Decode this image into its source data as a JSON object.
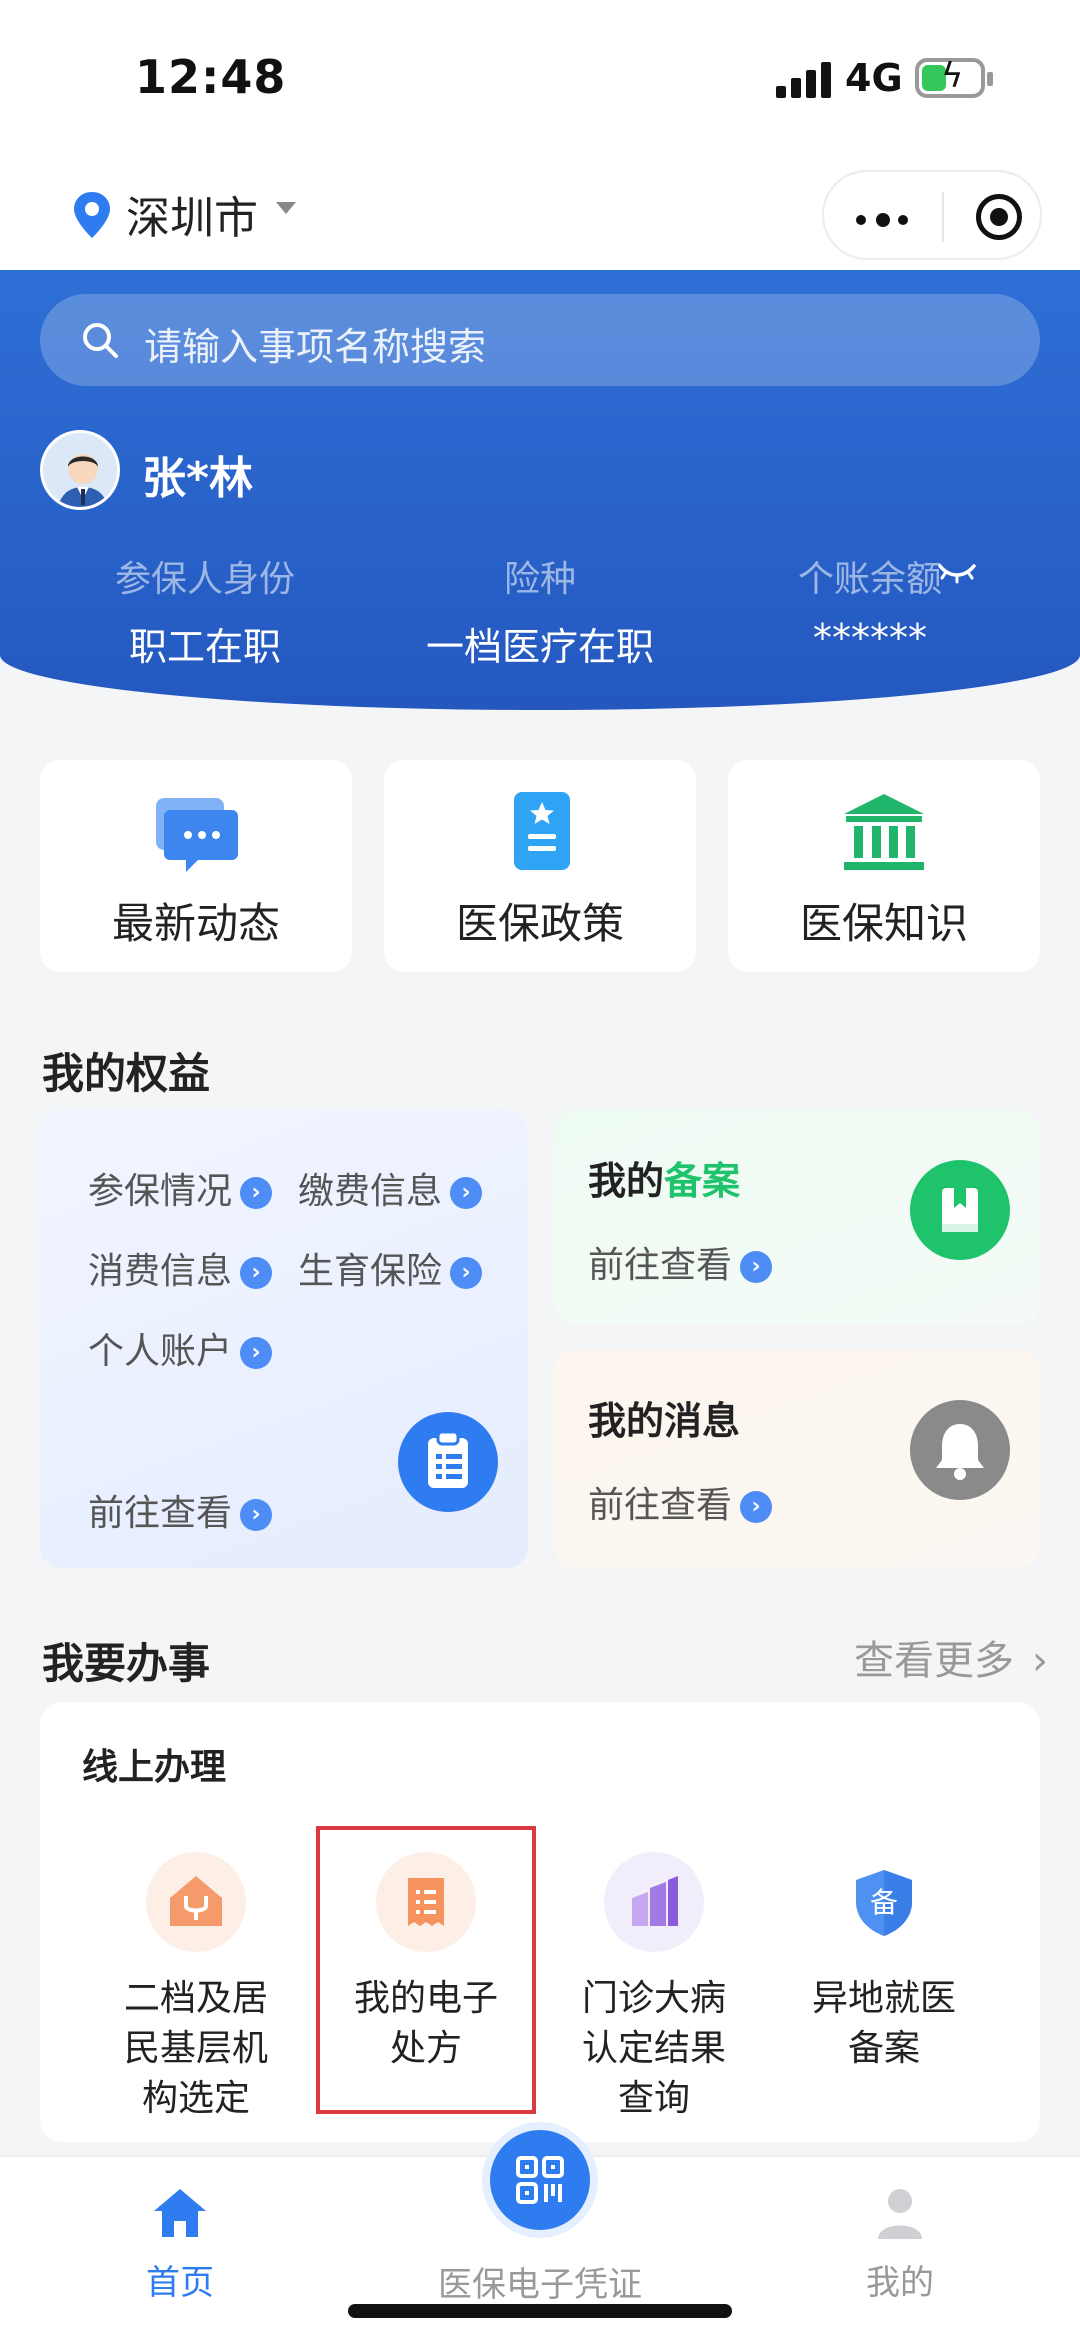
{
  "status_bar": {
    "time": "12:48",
    "network": "4G"
  },
  "nav": {
    "city": "深圳市"
  },
  "search": {
    "placeholder": "请输入事项名称搜索"
  },
  "user": {
    "name": "张*林",
    "fields": [
      {
        "label": "参保人身份",
        "value": "职工在职"
      },
      {
        "label": "险种",
        "value": "一档医疗在职"
      },
      {
        "label": "个账余额",
        "value": "******"
      }
    ]
  },
  "quick_links": [
    {
      "label": "最新动态",
      "icon": "chat-bubble-icon"
    },
    {
      "label": "医保政策",
      "icon": "policy-document-icon"
    },
    {
      "label": "医保知识",
      "icon": "institution-building-icon"
    }
  ],
  "rights": {
    "title": "我的权益",
    "items": [
      "参保情况",
      "缴费信息",
      "消费信息",
      "生育保险",
      "个人账户"
    ],
    "go_view": "前往查看",
    "filing": {
      "title_prefix": "我的",
      "title_highlight": "备案",
      "link": "前往查看"
    },
    "messages": {
      "title": "我的消息",
      "link": "前往查看"
    }
  },
  "services": {
    "title": "我要办事",
    "more": "查看更多",
    "subtitle": "线上办理",
    "items": [
      {
        "line1": "二档及居",
        "line2": "民基层机",
        "line3": "构选定",
        "icon": "house-stethoscope-icon"
      },
      {
        "line1": "我的电子",
        "line2": "处方",
        "line3": "",
        "icon": "prescription-receipt-icon"
      },
      {
        "line1": "门诊大病",
        "line2": "认定结果",
        "line3": "查询",
        "icon": "bar-chart-icon"
      },
      {
        "line1": "异地就医",
        "line2": "备案",
        "line3": "",
        "icon": "shield-bei-icon"
      }
    ],
    "shield_char": "备"
  },
  "tabbar": {
    "home": "首页",
    "voucher": "医保电子凭证",
    "mine": "我的"
  },
  "colors": {
    "primary": "#2f7bf0",
    "hero": "#2458bf",
    "green": "#1fc36b",
    "highlight_border": "#d93a3f"
  }
}
